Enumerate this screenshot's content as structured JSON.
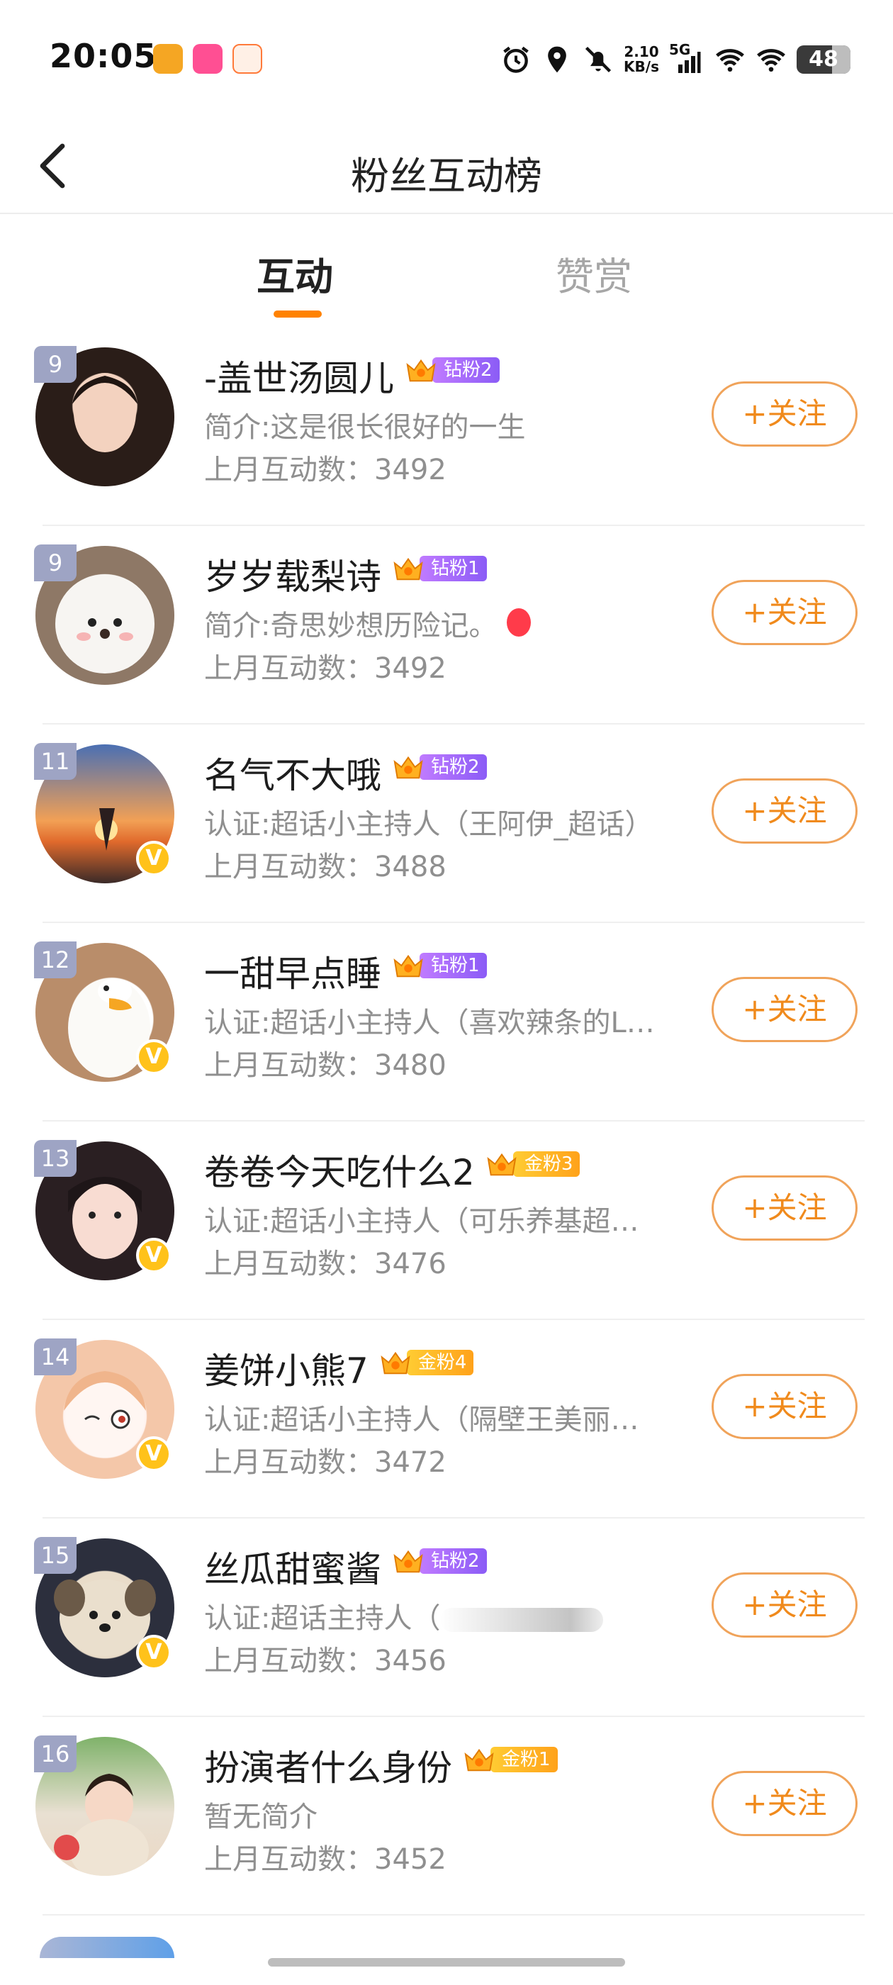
{
  "status_bar": {
    "time": "20:05",
    "net_speed_value": "2.10",
    "net_speed_unit": "KB/s",
    "network": "5G",
    "battery": "48",
    "icons": [
      "alarm-icon",
      "location-icon",
      "mute-bell-icon",
      "signal-icon",
      "wifi-icon",
      "wifi-icon",
      "battery-icon"
    ]
  },
  "nav": {
    "back_icon": "chevron-left-icon",
    "title": "粉丝互动榜"
  },
  "tabs": [
    {
      "label": "互动",
      "active": true
    },
    {
      "label": "赞赏",
      "active": false
    }
  ],
  "colors": {
    "accent": "#ff8200",
    "follow_border": "#f0a35a",
    "rank_badge": "#9ea4c4",
    "verified": "#ffc21a",
    "diamond_badge": "#a56bff",
    "gold_badge": "#ffb020"
  },
  "follow_label": "+关注",
  "fans": [
    {
      "rank": "9",
      "name": "-盖世汤圆儿",
      "badge_level": "钻粉2",
      "badge_type": "diamond",
      "bio": "简介:这是很长很好的一生",
      "count": "上月互动数：3492",
      "verified": false
    },
    {
      "rank": "9",
      "name": "岁岁载梨诗",
      "badge_level": "钻粉1",
      "badge_type": "diamond",
      "bio": "简介:奇思妙想历险记。",
      "count": "上月互动数：3492",
      "verified": false
    },
    {
      "rank": "11",
      "name": "名气不大哦",
      "badge_level": "钻粉2",
      "badge_type": "diamond",
      "bio": "认证:超话小主持人（王阿伊_超话）",
      "count": "上月互动数：3488",
      "verified": true
    },
    {
      "rank": "12",
      "name": "一甜早点睡",
      "badge_level": "钻粉1",
      "badge_type": "diamond",
      "bio": "认证:超话小主持人（喜欢辣条的L…",
      "count": "上月互动数：3480",
      "verified": true
    },
    {
      "rank": "13",
      "name": "卷卷今天吃什么2",
      "badge_level": "金粉3",
      "badge_type": "gold",
      "bio": "认证:超话小主持人（可乐养基超…",
      "count": "上月互动数：3476",
      "verified": true
    },
    {
      "rank": "14",
      "name": "姜饼小熊7",
      "badge_level": "金粉4",
      "badge_type": "gold",
      "bio": "认证:超话小主持人（隔壁王美丽…",
      "count": "上月互动数：3472",
      "verified": true
    },
    {
      "rank": "15",
      "name": "丝瓜甜蜜酱",
      "badge_level": "钻粉2",
      "badge_type": "diamond",
      "bio": "认证:超话主持人（",
      "count": "上月互动数：3456",
      "verified": true
    },
    {
      "rank": "16",
      "name": "扮演者什么身份",
      "badge_level": "金粉1",
      "badge_type": "gold",
      "bio": "暂无简介",
      "count": "上月互动数：3452",
      "verified": false
    }
  ]
}
